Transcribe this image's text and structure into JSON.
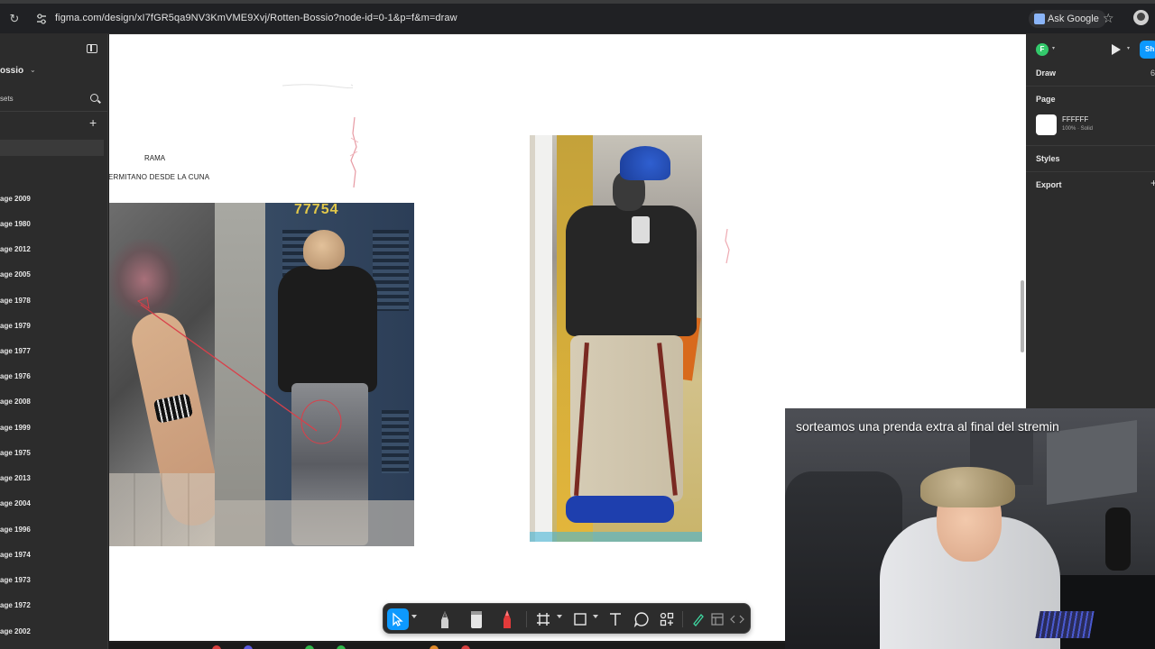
{
  "browser": {
    "url": "figma.com/design/xI7fGR5qa9NV3KmVME9Xvj/Rotten-Bossio?node-id=0-1&p=f&m=draw",
    "ask_google_label": "Ask Google"
  },
  "left_panel": {
    "file_name": "ossio",
    "assets_label": "sets",
    "pages": [
      "age 2009",
      "age 1980",
      "age 2012",
      "age 2005",
      "age 1978",
      "age 1979",
      "age 1977",
      "age 1976",
      "age 2008",
      "age 1999",
      "age 1975",
      "age 2013",
      "age 2004",
      "age 1996",
      "age 1974",
      "age 1973",
      "age 1972",
      "age 2002"
    ]
  },
  "canvas": {
    "text_rama": "RAMA",
    "text_ermitano": "ERMITANO DESDE LA CUNA",
    "door_number": "77754"
  },
  "toolbar": {
    "tools": [
      "move-tool",
      "pen-tool",
      "marker-tool",
      "highlighter-tool",
      "frame-tool",
      "shape-tool",
      "text-tool",
      "comment-tool",
      "actions-tool",
      "draw-mode-toggle",
      "design-mode-toggle",
      "dev-mode-toggle"
    ]
  },
  "right_panel": {
    "user_initial": "F",
    "share_label": "Sh",
    "mode_label": "Draw",
    "zoom_label": "6",
    "page_section_title": "Page",
    "page_color_hex": "FFFFFF",
    "page_color_opacity": "100% · Solid",
    "styles_title": "Styles",
    "export_title": "Export"
  },
  "webcam": {
    "caption": "sorteamos una prenda extra al final del stremin"
  },
  "colors": {
    "figma_blue": "#0d99ff",
    "panel_bg": "#2c2c2c",
    "canvas_bg": "#ffffff",
    "user_avatar": "#33c96b"
  }
}
